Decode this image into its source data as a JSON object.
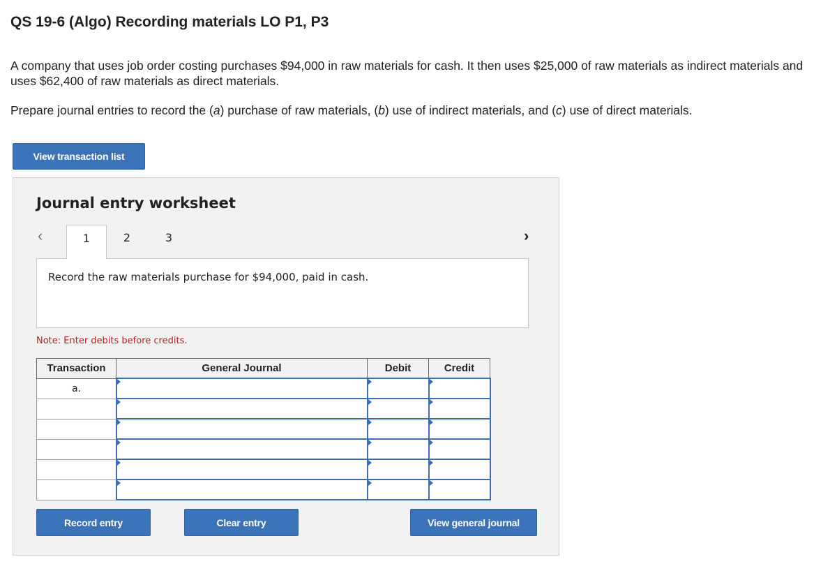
{
  "header": {
    "title": "QS 19-6 (Algo) Recording materials LO P1, P3"
  },
  "problem": {
    "paragraph1": "A company that uses job order costing purchases $94,000 in raw materials for cash. It then uses $25,000 of raw materials as indirect materials and uses $62,400 of raw materials as direct materials.",
    "paragraph2": "Prepare journal entries to record the (a) purchase of raw materials, (b) use of indirect materials, and (c) use of direct materials."
  },
  "buttons": {
    "view_transaction_list": "View transaction list",
    "record_entry": "Record entry",
    "clear_entry": "Clear entry",
    "view_general_journal": "View general journal"
  },
  "worksheet": {
    "title": "Journal entry worksheet",
    "nav_prev_icon": "‹",
    "nav_next_icon": "›",
    "tabs": [
      {
        "label": "1",
        "active": true
      },
      {
        "label": "2",
        "active": false
      },
      {
        "label": "3",
        "active": false
      }
    ],
    "description": "Record the raw materials purchase for $94,000, paid in cash.",
    "note": "Note: Enter debits before credits."
  },
  "journal_table": {
    "headers": [
      "Transaction",
      "General Journal",
      "Debit",
      "Credit"
    ],
    "rows": [
      {
        "transaction": "a.",
        "account": "",
        "debit": "",
        "credit": ""
      },
      {
        "transaction": "",
        "account": "",
        "debit": "",
        "credit": ""
      },
      {
        "transaction": "",
        "account": "",
        "debit": "",
        "credit": ""
      },
      {
        "transaction": "",
        "account": "",
        "debit": "",
        "credit": ""
      },
      {
        "transaction": "",
        "account": "",
        "debit": "",
        "credit": ""
      },
      {
        "transaction": "",
        "account": "",
        "debit": "",
        "credit": ""
      }
    ]
  },
  "colors": {
    "accent": "#3b73b9",
    "note": "#b22222",
    "panel_bg": "#f2f2f2"
  }
}
